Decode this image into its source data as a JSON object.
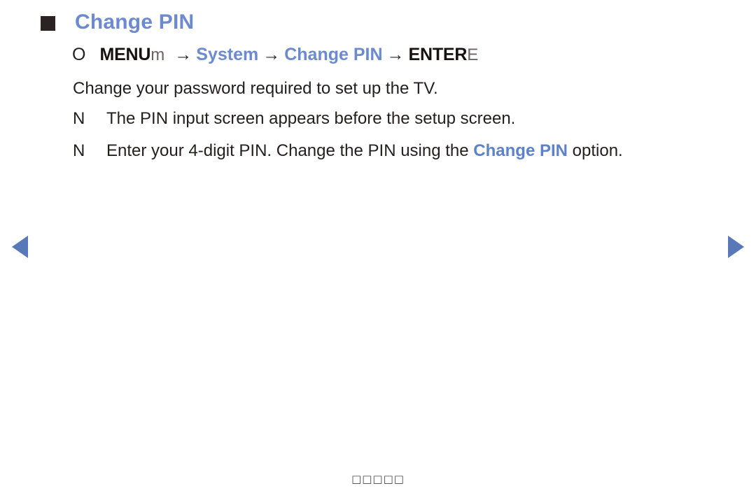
{
  "section": {
    "bullet_icon": "filled-square-icon",
    "title": "Change PIN"
  },
  "menu_path": {
    "marker_icon": "circle-marker-icon",
    "marker": "O",
    "menu_key_label": "MENU",
    "menu_key_glyph": "m",
    "arrow": "→",
    "step_system": "System",
    "step_change_pin": "Change PIN",
    "enter_key_label": "ENTER",
    "enter_key_glyph": "E",
    "full_text": "MENUm → System → Change PIN → ENTERE"
  },
  "description": "Change your password required to set up the TV.",
  "notes": [
    {
      "marker_icon": "note-marker-icon",
      "marker": "N",
      "text_before": "The PIN input screen appears before the setup screen.",
      "highlight": "",
      "text_after": ""
    },
    {
      "marker_icon": "note-marker-icon",
      "marker": "N",
      "text_before": "Enter your 4-digit PIN. Change the PIN using the ",
      "highlight": "Change PIN",
      "text_after": " option."
    }
  ],
  "navigation": {
    "prev_icon": "left-triangle-icon",
    "prev_label": "◀",
    "next_icon": "right-triangle-icon",
    "next_label": "▶"
  },
  "footer": {
    "text": "□□□□□"
  },
  "colors": {
    "accent_blue": "#6b8ad0",
    "link_blue": "#5c82cc",
    "arrow_blue": "#5878b8",
    "text_black": "#231f1f",
    "bullet_dark": "#2b2323",
    "background": "#ffffff"
  }
}
